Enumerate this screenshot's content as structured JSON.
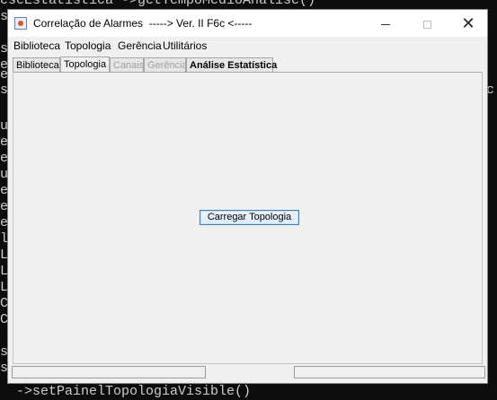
{
  "console": {
    "lines": [
      "eseEstatistica ->getTempoMedioAnalise()",
      "se",
      "se",
      "es",
      "es",
      "se",
      "",
      "um",
      "et",
      "et",
      "um",
      "et",
      "et",
      "et",
      "li",
      "Lo",
      "Lo",
      "Lo",
      "Ce",
      "Ce",
      "",
      "se",
      "se",
      "  ->setPainelTopologiaVisible()"
    ],
    "right_text": "c"
  },
  "window": {
    "title": "Correlação de Alarmes  -----> Ver. II F6c <-----",
    "controls": {
      "minimize": "",
      "maximize": "",
      "close": "✕"
    }
  },
  "menubar": [
    "Biblioteca",
    "Topologia",
    "Gerência",
    "Utilitários"
  ],
  "tabs": [
    {
      "label": "Biblioteca",
      "state": "normal"
    },
    {
      "label": "Topologia",
      "state": "selected"
    },
    {
      "label": "Canais",
      "state": "disabled"
    },
    {
      "label": "Gerência",
      "state": "disabled"
    },
    {
      "label": "Análise Estatística",
      "state": "normal"
    }
  ],
  "panel": {
    "button_label": "Carregar Topologia"
  }
}
